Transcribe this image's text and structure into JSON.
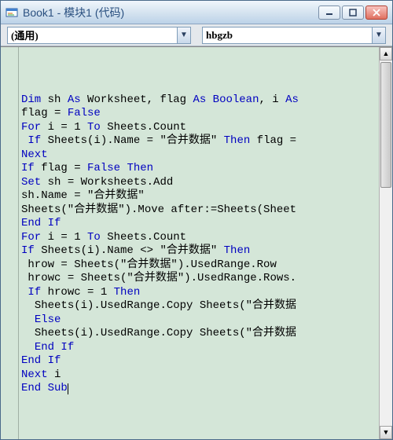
{
  "window": {
    "title": "Book1 - 模块1 (代码)"
  },
  "dropdowns": {
    "left": "(通用)",
    "right": "hbgzb"
  },
  "code_lines": [
    {
      "indent": 0,
      "tokens": [
        {
          "t": "Dim",
          "k": 1
        },
        {
          "t": " sh "
        },
        {
          "t": "As",
          "k": 1
        },
        {
          "t": " Worksheet, flag "
        },
        {
          "t": "As Boolean",
          "k": 1
        },
        {
          "t": ", i "
        },
        {
          "t": "As",
          "k": 1
        },
        {
          "t": " "
        }
      ]
    },
    {
      "indent": 0,
      "tokens": [
        {
          "t": "flag = "
        },
        {
          "t": "False",
          "k": 1
        }
      ]
    },
    {
      "indent": 0,
      "tokens": [
        {
          "t": "For",
          "k": 1
        },
        {
          "t": " i = 1 "
        },
        {
          "t": "To",
          "k": 1
        },
        {
          "t": " Sheets.Count"
        }
      ]
    },
    {
      "indent": 1,
      "tokens": [
        {
          "t": "If",
          "k": 1
        },
        {
          "t": " Sheets(i).Name = \"合并数据\" "
        },
        {
          "t": "Then",
          "k": 1
        },
        {
          "t": " flag ="
        }
      ]
    },
    {
      "indent": 0,
      "tokens": [
        {
          "t": "Next",
          "k": 1
        }
      ]
    },
    {
      "indent": 0,
      "tokens": [
        {
          "t": "If",
          "k": 1
        },
        {
          "t": " flag = "
        },
        {
          "t": "False Then",
          "k": 1
        }
      ]
    },
    {
      "indent": 0,
      "tokens": [
        {
          "t": "Set",
          "k": 1
        },
        {
          "t": " sh = Worksheets.Add"
        }
      ]
    },
    {
      "indent": 0,
      "tokens": [
        {
          "t": "sh.Name = \"合并数据\""
        }
      ]
    },
    {
      "indent": 0,
      "tokens": [
        {
          "t": "Sheets(\"合并数据\").Move after:=Sheets(Sheet"
        }
      ]
    },
    {
      "indent": 0,
      "tokens": [
        {
          "t": "End If",
          "k": 1
        }
      ]
    },
    {
      "indent": 0,
      "tokens": [
        {
          "t": ""
        }
      ]
    },
    {
      "indent": 0,
      "tokens": [
        {
          "t": "For",
          "k": 1
        },
        {
          "t": " i = 1 "
        },
        {
          "t": "To",
          "k": 1
        },
        {
          "t": " Sheets.Count"
        }
      ]
    },
    {
      "indent": 0,
      "tokens": [
        {
          "t": "If",
          "k": 1
        },
        {
          "t": " Sheets(i).Name <> \"合并数据\" "
        },
        {
          "t": "Then",
          "k": 1
        }
      ]
    },
    {
      "indent": 1,
      "tokens": [
        {
          "t": "hrow = Sheets(\"合并数据\").UsedRange.Row"
        }
      ]
    },
    {
      "indent": 1,
      "tokens": [
        {
          "t": "hrowc = Sheets(\"合并数据\").UsedRange.Rows."
        }
      ]
    },
    {
      "indent": 1,
      "tokens": [
        {
          "t": "If",
          "k": 1
        },
        {
          "t": " hrowc = 1 "
        },
        {
          "t": "Then",
          "k": 1
        }
      ]
    },
    {
      "indent": 2,
      "tokens": [
        {
          "t": "Sheets(i).UsedRange.Copy Sheets(\"合并数据"
        }
      ]
    },
    {
      "indent": 2,
      "tokens": [
        {
          "t": "Else",
          "k": 1
        }
      ]
    },
    {
      "indent": 2,
      "tokens": [
        {
          "t": "Sheets(i).UsedRange.Copy Sheets(\"合并数据"
        }
      ]
    },
    {
      "indent": 2,
      "tokens": [
        {
          "t": "End If",
          "k": 1
        }
      ]
    },
    {
      "indent": 0,
      "tokens": [
        {
          "t": "End If",
          "k": 1
        }
      ]
    },
    {
      "indent": 0,
      "tokens": [
        {
          "t": "Next",
          "k": 1
        },
        {
          "t": " i"
        }
      ]
    },
    {
      "indent": 0,
      "tokens": [
        {
          "t": "End Sub",
          "k": 1
        }
      ],
      "cursor": true
    }
  ]
}
